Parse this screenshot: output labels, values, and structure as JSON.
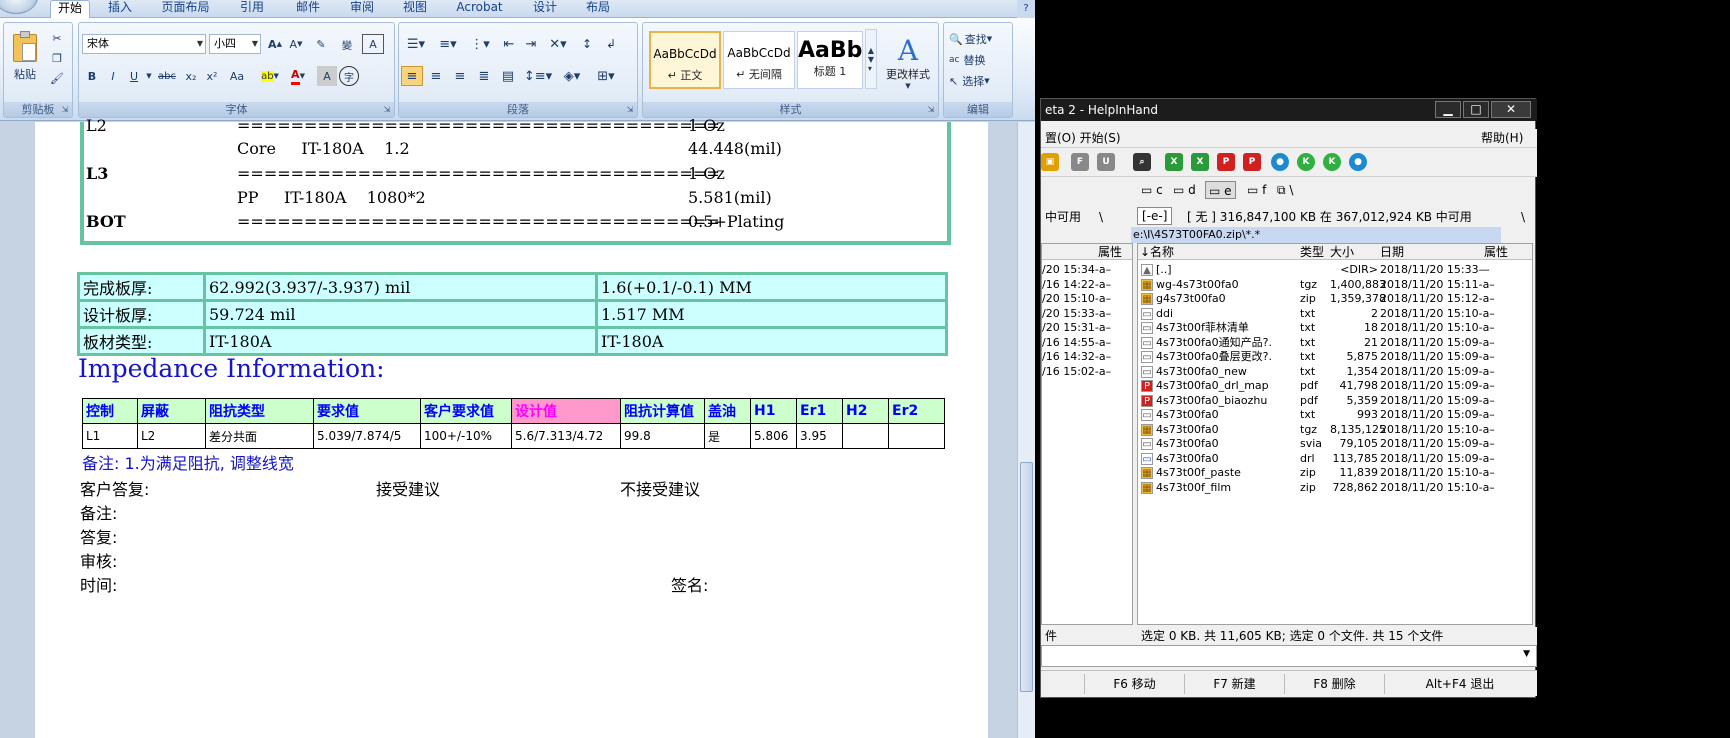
{
  "word": {
    "tabs": [
      "开始",
      "插入",
      "页面布局",
      "引用",
      "邮件",
      "审阅",
      "视图",
      "Acrobat",
      "设计",
      "布局"
    ],
    "active_tab": "开始",
    "clipboard": {
      "paste_label": "粘贴",
      "group_label": "剪贴板"
    },
    "font": {
      "name": "宋体",
      "size": "小四",
      "group_label": "字体",
      "buttons": [
        "B",
        "I",
        "U",
        "abc",
        "x₂",
        "x²",
        "Aa"
      ],
      "grow": "A",
      "shrink": "A"
    },
    "paragraph": {
      "group_label": "段落"
    },
    "styles": {
      "group_label": "样式",
      "tiles": [
        {
          "sample": "AaBbCcDd",
          "name": "↵ 正文"
        },
        {
          "sample": "AaBbCcDd",
          "name": "↵ 无间隔"
        },
        {
          "sample": "AaBb",
          "name": "标题 1"
        }
      ],
      "change_styles": "更改样式"
    },
    "editing": {
      "group_label": "编辑",
      "find": "查找",
      "replace": "替换",
      "select": "选择"
    },
    "stackup": [
      {
        "layer": "L2",
        "material": "",
        "line": "====================================",
        "value": "1 Oz"
      },
      {
        "layer": "",
        "material": "Core     IT-180A    1.2",
        "line": "",
        "value": "44.448(mil)"
      },
      {
        "layer": "L3",
        "material": "",
        "line": "====================================",
        "value": "1 Oz"
      },
      {
        "layer": "",
        "material": "PP     IT-180A    1080*2",
        "line": "",
        "value": "5.581(mil)"
      },
      {
        "layer": "BOT",
        "material": "",
        "line": "====================================",
        "value": "0.5+Plating"
      }
    ],
    "thickness": [
      {
        "label": "完成板厚:",
        "mil": "62.992(3.937/-3.937) mil",
        "mm": "1.6(+0.1/-0.1) MM"
      },
      {
        "label": "设计板厚:",
        "mil": "59.724 mil",
        "mm": "1.517 MM"
      },
      {
        "label": "板材类型:",
        "mil": "IT-180A",
        "mm": "IT-180A"
      }
    ],
    "impedance_title": "Impedance Information:",
    "impedance_headers": [
      "控制",
      "屏蔽",
      "阻抗类型",
      "要求值",
      "客户要求值",
      "设计值",
      "阻抗计算值",
      "盖油",
      "H1",
      "Er1",
      "H2",
      "Er2"
    ],
    "impedance_rows": [
      [
        "L1",
        "L2",
        "差分共面",
        "5.039/7.874/5",
        "100+/-10%",
        "5.6/7.313/4.72",
        "99.8",
        "是",
        "5.806",
        "3.95",
        "",
        ""
      ]
    ],
    "remark": "备注: 1.为满足阻抗, 调整线宽",
    "customer_reply": "客户答复:",
    "accept": "接受建议",
    "reject": "不接受建议",
    "notes": "备注:",
    "reply": "答复:",
    "review": "审核:",
    "time": "时间:",
    "signature": "签名:"
  },
  "tc": {
    "title": "eta 2 - HelpInHand",
    "menu_left": "置(O)   开始(S)",
    "menu_help": "帮助(H)",
    "drives": [
      "c",
      "d",
      "e",
      "f"
    ],
    "active_drive": "e",
    "left_free": "中可用",
    "right_drive_combo": "[-e-]",
    "right_free": "[ 无 ]  316,847,100 KB 在 367,012,924 KB 中可用",
    "path": "e:\\I\\4S73T00FA0.zip\\*.*",
    "left_col": "属性",
    "columns": [
      "↓名称",
      "类型",
      "大小",
      "日期",
      "属性"
    ],
    "left_dates": [
      "/20 15:34-a–",
      "/16 14:22-a–",
      "/20 15:10-a–",
      "/20 15:33-a–",
      "/20 15:31-a–",
      "/16 14:55-a–",
      "/16 14:32-a–",
      "/16 15:02-a–"
    ],
    "files": [
      {
        "name": "[..]",
        "type": "",
        "size": "<DIR>",
        "date": "2018/11/20 15:33—",
        "icon": "up"
      },
      {
        "name": "wg-4s73t00fa0",
        "type": "tgz",
        "size": "1,400,883",
        "date": "2018/11/20 15:11-a–",
        "icon": "zip"
      },
      {
        "name": "g4s73t00fa0",
        "type": "zip",
        "size": "1,359,378",
        "date": "2018/11/20 15:12-a–",
        "icon": "zip"
      },
      {
        "name": "ddi",
        "type": "txt",
        "size": "2",
        "date": "2018/11/20 15:10-a–",
        "icon": "doc"
      },
      {
        "name": "4s73t00f菲林清单",
        "type": "txt",
        "size": "18",
        "date": "2018/11/20 15:10-a–",
        "icon": "doc"
      },
      {
        "name": "4s73t00fa0通知产品?.",
        "type": "txt",
        "size": "21",
        "date": "2018/11/20 15:09-a–",
        "icon": "doc"
      },
      {
        "name": "4s73t00fa0叠层更改?.",
        "type": "txt",
        "size": "5,875",
        "date": "2018/11/20 15:09-a–",
        "icon": "doc"
      },
      {
        "name": "4s73t00fa0_new",
        "type": "txt",
        "size": "1,354",
        "date": "2018/11/20 15:09-a–",
        "icon": "doc"
      },
      {
        "name": "4s73t00fa0_drl_map",
        "type": "pdf",
        "size": "41,798",
        "date": "2018/11/20 15:09-a–",
        "icon": "pdf"
      },
      {
        "name": "4s73t00fa0_biaozhu",
        "type": "pdf",
        "size": "5,359",
        "date": "2018/11/20 15:09-a–",
        "icon": "pdf"
      },
      {
        "name": "4s73t00fa0",
        "type": "txt",
        "size": "993",
        "date": "2018/11/20 15:09-a–",
        "icon": "doc"
      },
      {
        "name": "4s73t00fa0",
        "type": "tgz",
        "size": "8,135,125",
        "date": "2018/11/20 15:10-a–",
        "icon": "zip"
      },
      {
        "name": "4s73t00fa0",
        "type": "svia",
        "size": "79,105",
        "date": "2018/11/20 15:09-a–",
        "icon": "doc"
      },
      {
        "name": "4s73t00fa0",
        "type": "drl",
        "size": "113,785",
        "date": "2018/11/20 15:09-a–",
        "icon": "win"
      },
      {
        "name": "4s73t00f_paste",
        "type": "zip",
        "size": "11,839",
        "date": "2018/11/20 15:10-a–",
        "icon": "zip"
      },
      {
        "name": "4s73t00f_film",
        "type": "zip",
        "size": "728,862",
        "date": "2018/11/20 15:10-a–",
        "icon": "zip"
      }
    ],
    "status_left": "件",
    "status_right": "选定 0 KB. 共 11,605 KB; 选定 0 个文件. 共 15 个文件",
    "fkeys": [
      "F6 移动",
      "F7 新建",
      "F8 删除",
      "Alt+F4 退出"
    ]
  }
}
